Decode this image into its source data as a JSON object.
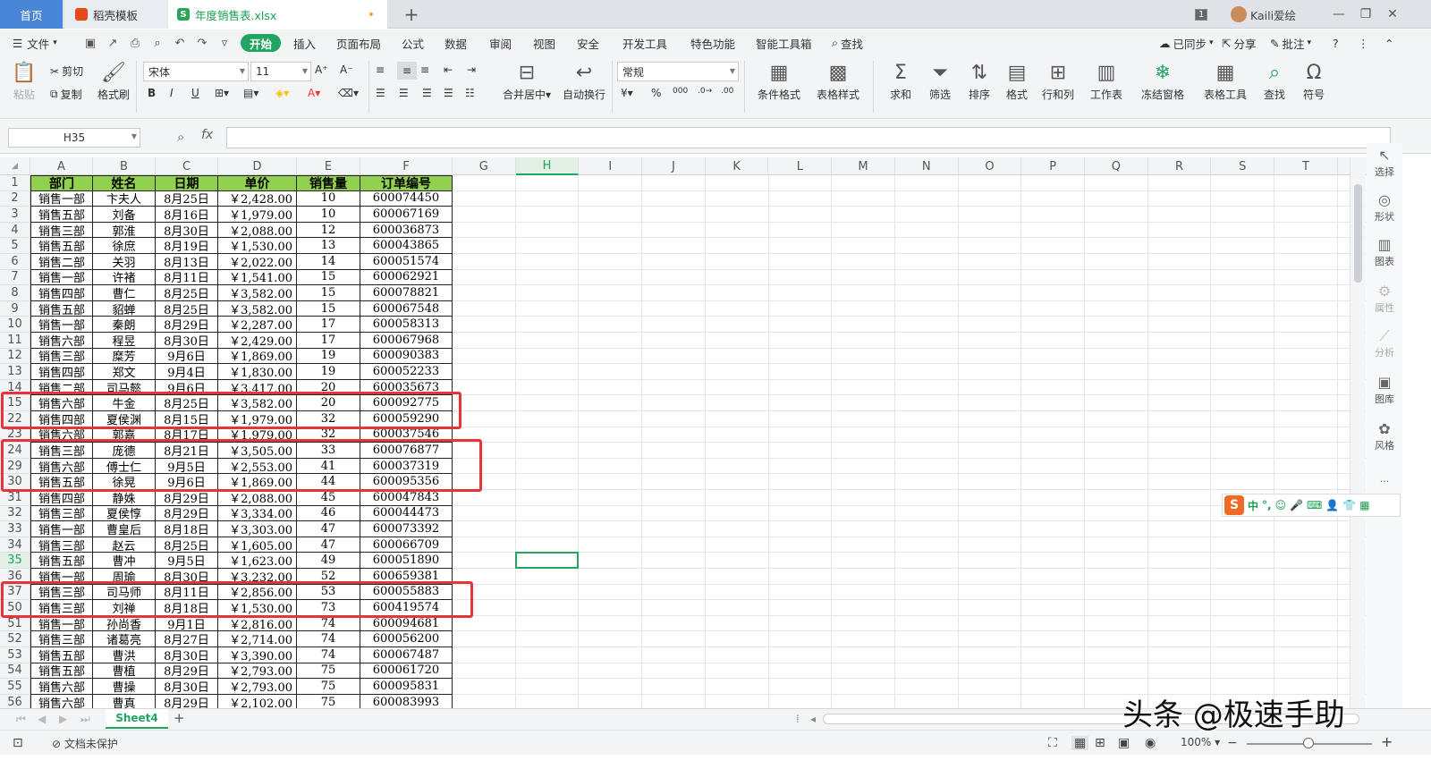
{
  "titlebar": {
    "tab_home": "首页",
    "tab_template": "稻壳模板",
    "tab_file": "年度销售表.xlsx",
    "tab_file_dot": "•",
    "tab_add": "+",
    "badge": "1",
    "user": "Kaili爱绘"
  },
  "menubar": {
    "file": "文件",
    "items": [
      "开始",
      "插入",
      "页面布局",
      "公式",
      "数据",
      "审阅",
      "视图",
      "安全",
      "开发工具",
      "特色功能",
      "智能工具箱",
      "查找"
    ],
    "right": [
      "已同步",
      "分享",
      "批注"
    ]
  },
  "ribbon": {
    "paste": "粘贴",
    "cut": "剪切",
    "copy": "复制",
    "format_painter": "格式刷",
    "font_name": "宋体",
    "font_size": "11",
    "number_format": "常规",
    "merge_center": "合并居中",
    "wrap_text": "自动换行",
    "cond_format": "条件格式",
    "table_style": "表格样式",
    "sum": "求和",
    "filter": "筛选",
    "sort": "排序",
    "format": "格式",
    "row_col": "行和列",
    "worksheet": "工作表",
    "freeze": "冻结窗格",
    "table_tools": "表格工具",
    "find": "查找",
    "symbol": "符号"
  },
  "formula_bar": {
    "name_box": "H35",
    "fx": "fx",
    "formula": ""
  },
  "columns": [
    "A",
    "B",
    "C",
    "D",
    "E",
    "F",
    "G",
    "H",
    "I",
    "J",
    "K",
    "L",
    "M",
    "N",
    "O",
    "P",
    "Q",
    "R",
    "S",
    "T"
  ],
  "selected_column": "H",
  "table_header": [
    "部门",
    "姓名",
    "日期",
    "单价",
    "销售量",
    "订单编号"
  ],
  "rows": [
    {
      "n": "2",
      "dept": "销售一部",
      "name": "卞夫人",
      "date": "8月25日",
      "price": "￥2,428.00",
      "qty": "10",
      "order": "600074450"
    },
    {
      "n": "3",
      "dept": "销售五部",
      "name": "刘备",
      "date": "8月16日",
      "price": "￥1,979.00",
      "qty": "10",
      "order": "600067169"
    },
    {
      "n": "4",
      "dept": "销售三部",
      "name": "郭淮",
      "date": "8月30日",
      "price": "￥2,088.00",
      "qty": "12",
      "order": "600036873"
    },
    {
      "n": "5",
      "dept": "销售五部",
      "name": "徐庶",
      "date": "8月19日",
      "price": "￥1,530.00",
      "qty": "13",
      "order": "600043865"
    },
    {
      "n": "6",
      "dept": "销售二部",
      "name": "关羽",
      "date": "8月13日",
      "price": "￥2,022.00",
      "qty": "14",
      "order": "600051574"
    },
    {
      "n": "7",
      "dept": "销售一部",
      "name": "许褚",
      "date": "8月11日",
      "price": "￥1,541.00",
      "qty": "15",
      "order": "600062921"
    },
    {
      "n": "8",
      "dept": "销售四部",
      "name": "曹仁",
      "date": "8月25日",
      "price": "￥3,582.00",
      "qty": "15",
      "order": "600078821"
    },
    {
      "n": "9",
      "dept": "销售五部",
      "name": "貂蝉",
      "date": "8月25日",
      "price": "￥3,582.00",
      "qty": "15",
      "order": "600067548"
    },
    {
      "n": "10",
      "dept": "销售一部",
      "name": "秦朗",
      "date": "8月29日",
      "price": "￥2,287.00",
      "qty": "17",
      "order": "600058313"
    },
    {
      "n": "11",
      "dept": "销售六部",
      "name": "程昱",
      "date": "8月30日",
      "price": "￥2,429.00",
      "qty": "17",
      "order": "600067968"
    },
    {
      "n": "12",
      "dept": "销售三部",
      "name": "糜芳",
      "date": "9月6日",
      "price": "￥1,869.00",
      "qty": "19",
      "order": "600090383"
    },
    {
      "n": "13",
      "dept": "销售四部",
      "name": "郑文",
      "date": "9月4日",
      "price": "￥1,830.00",
      "qty": "19",
      "order": "600052233"
    },
    {
      "n": "14",
      "dept": "销售二部",
      "name": "司马懿",
      "date": "9月6日",
      "price": "￥3,417.00",
      "qty": "20",
      "order": "600035673"
    },
    {
      "n": "15",
      "dept": "销售六部",
      "name": "牛金",
      "date": "8月25日",
      "price": "￥3,582.00",
      "qty": "20",
      "order": "600092775"
    },
    {
      "n": "22",
      "dept": "销售四部",
      "name": "夏侯渊",
      "date": "8月15日",
      "price": "￥1,979.00",
      "qty": "32",
      "order": "600059290"
    },
    {
      "n": "23",
      "dept": "销售六部",
      "name": "郭嘉",
      "date": "8月17日",
      "price": "￥1,979.00",
      "qty": "32",
      "order": "600037546"
    },
    {
      "n": "24",
      "dept": "销售三部",
      "name": "庞德",
      "date": "8月21日",
      "price": "￥3,505.00",
      "qty": "33",
      "order": "600076877"
    },
    {
      "n": "29",
      "dept": "销售六部",
      "name": "傅士仁",
      "date": "9月5日",
      "price": "￥2,553.00",
      "qty": "41",
      "order": "600037319"
    },
    {
      "n": "30",
      "dept": "销售五部",
      "name": "徐晃",
      "date": "9月6日",
      "price": "￥1,869.00",
      "qty": "44",
      "order": "600095356"
    },
    {
      "n": "31",
      "dept": "销售四部",
      "name": "静姝",
      "date": "8月29日",
      "price": "￥2,088.00",
      "qty": "45",
      "order": "600047843"
    },
    {
      "n": "32",
      "dept": "销售三部",
      "name": "夏侯惇",
      "date": "8月29日",
      "price": "￥3,334.00",
      "qty": "46",
      "order": "600044473"
    },
    {
      "n": "33",
      "dept": "销售一部",
      "name": "曹皇后",
      "date": "8月18日",
      "price": "￥3,303.00",
      "qty": "47",
      "order": "600073392"
    },
    {
      "n": "34",
      "dept": "销售三部",
      "name": "赵云",
      "date": "8月25日",
      "price": "￥1,605.00",
      "qty": "47",
      "order": "600066709"
    },
    {
      "n": "35",
      "dept": "销售五部",
      "name": "曹冲",
      "date": "9月5日",
      "price": "￥1,623.00",
      "qty": "49",
      "order": "600051890"
    },
    {
      "n": "36",
      "dept": "销售一部",
      "name": "周瑜",
      "date": "8月30日",
      "price": "￥3,232.00",
      "qty": "52",
      "order": "600659381"
    },
    {
      "n": "37",
      "dept": "销售三部",
      "name": "司马师",
      "date": "8月11日",
      "price": "￥2,856.00",
      "qty": "53",
      "order": "600055883"
    },
    {
      "n": "50",
      "dept": "销售三部",
      "name": "刘禅",
      "date": "8月18日",
      "price": "￥1,530.00",
      "qty": "73",
      "order": "600419574"
    },
    {
      "n": "51",
      "dept": "销售一部",
      "name": "孙尚香",
      "date": "9月1日",
      "price": "￥2,816.00",
      "qty": "74",
      "order": "600094681"
    },
    {
      "n": "52",
      "dept": "销售三部",
      "name": "诸葛亮",
      "date": "8月27日",
      "price": "￥2,714.00",
      "qty": "74",
      "order": "600056200"
    },
    {
      "n": "53",
      "dept": "销售五部",
      "name": "曹洪",
      "date": "8月30日",
      "price": "￥3,390.00",
      "qty": "74",
      "order": "600067487"
    },
    {
      "n": "54",
      "dept": "销售五部",
      "name": "曹植",
      "date": "8月29日",
      "price": "￥2,793.00",
      "qty": "75",
      "order": "600061720"
    },
    {
      "n": "55",
      "dept": "销售六部",
      "name": "曹操",
      "date": "8月30日",
      "price": "￥2,793.00",
      "qty": "75",
      "order": "600095831"
    },
    {
      "n": "56",
      "dept": "销售六部",
      "name": "曹真",
      "date": "8月29日",
      "price": "￥2,102.00",
      "qty": "75",
      "order": "600083993"
    }
  ],
  "sidebar": [
    "选择",
    "形状",
    "图表",
    "属性",
    "分析",
    "图库",
    "风格"
  ],
  "ime": {
    "lang": "中"
  },
  "sheet_tab": "Sheet4",
  "sheet_add": "+",
  "status": {
    "protect": "文档未保护",
    "zoom": "100%"
  },
  "watermark": "头条 @极速手助",
  "colors": {
    "accent": "#21a560",
    "header_fill": "#92d050",
    "highlight_box": "#e8333b"
  }
}
